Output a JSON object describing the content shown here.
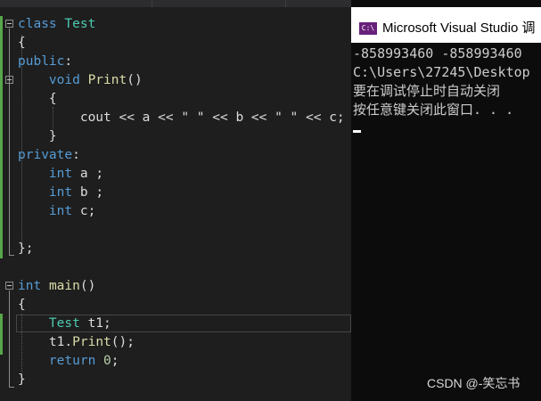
{
  "editor": {
    "lines": {
      "l1": {
        "kw": "class",
        "name": "Test"
      },
      "l2": {
        "text": "{"
      },
      "l3": {
        "kw": "public",
        "colon": ":"
      },
      "l4": {
        "kw": "void",
        "fn": "Print",
        "parens": "()"
      },
      "l5": {
        "text": "{"
      },
      "l6": {
        "text": "cout << a << \" \" << b << \" \" << c;"
      },
      "l7": {
        "text": "}"
      },
      "l8": {
        "kw": "private",
        "colon": ":"
      },
      "l9": {
        "kw": "int",
        "rest": " a ;"
      },
      "l10": {
        "kw": "int",
        "rest": " b ;"
      },
      "l11": {
        "kw": "int",
        "rest": " c;"
      },
      "l12": {
        "text": "};"
      },
      "l13": {
        "kw": "int",
        "fn": "main",
        "parens": "()"
      },
      "l14": {
        "text": "{"
      },
      "l15": {
        "type": "Test",
        "rest": " t1;"
      },
      "l16": {
        "obj": "t1.",
        "fn": "Print",
        "rest": "();"
      },
      "l17": {
        "kw": "return",
        "num": "0",
        "semi": ";"
      },
      "l18": {
        "text": "}"
      }
    }
  },
  "console": {
    "title": "Microsoft Visual Studio 调",
    "icon_text": "C:\\",
    "output": [
      "-858993460 -858993460",
      "C:\\Users\\27245\\Desktop",
      "要在调试停止时自动关闭",
      "按任意键关闭此窗口. . ."
    ]
  },
  "watermark": "CSDN @-笑忘书",
  "colors": {
    "keyword": "#569cd6",
    "type": "#4ec9b0",
    "function": "#dcdcaa",
    "number": "#b5cea8",
    "text": "#dcdcdc",
    "gutter_change": "#57a64a",
    "console_bg": "#0c0c0c"
  }
}
